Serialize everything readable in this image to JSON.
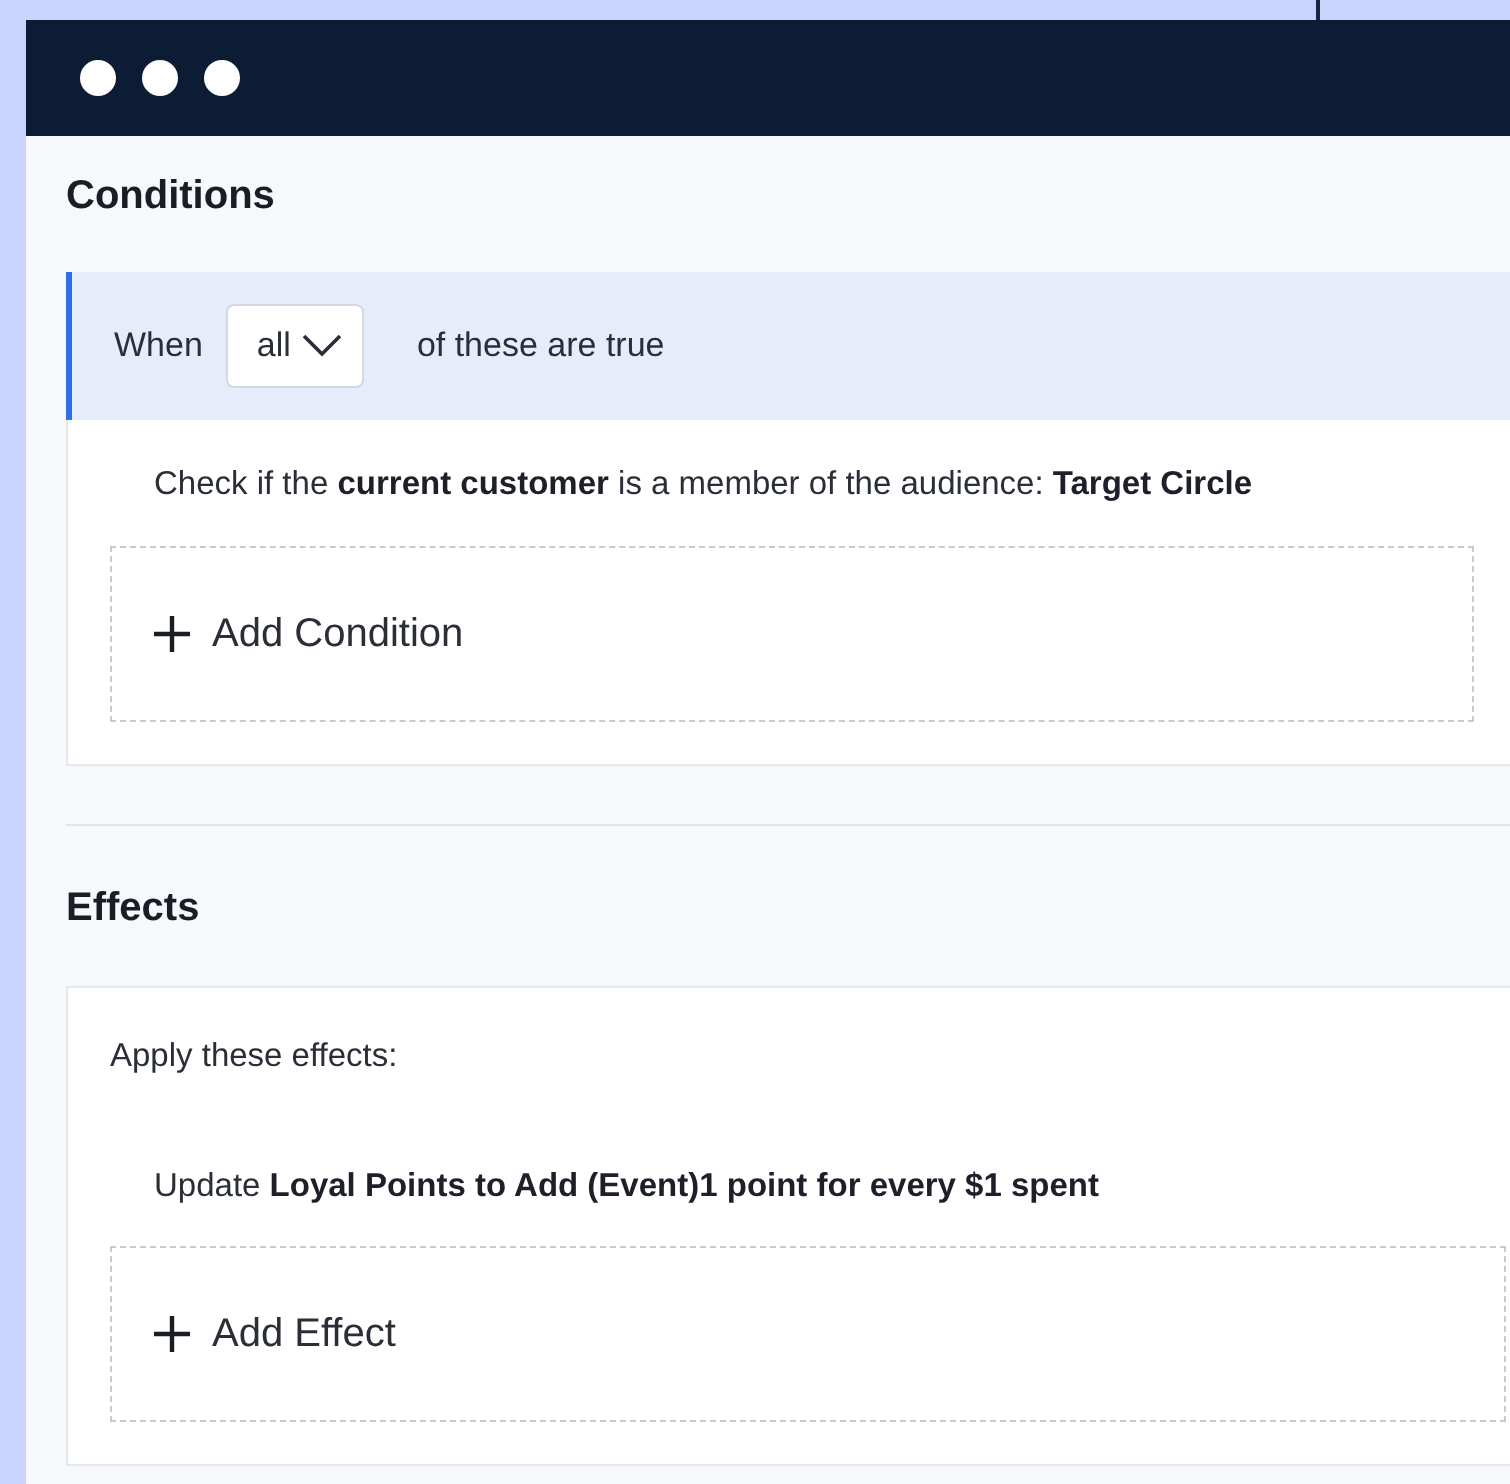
{
  "window": {
    "controls": [
      {
        "kind": "dot"
      },
      {
        "kind": "dot"
      },
      {
        "kind": "dot"
      }
    ]
  },
  "conditions": {
    "title": "Conditions",
    "group": {
      "prefix": "When",
      "quantifier": "all",
      "suffix": "of these are true",
      "focused": true
    },
    "items": [
      "Check if the **current customer** is a member of the audience: **Target Circle**"
    ],
    "add_button": "Add Condition"
  },
  "effects": {
    "title": "Effects",
    "intro": "Apply these effects:",
    "items": [
      "Update **Loyal Points to Add (Event)1 point for every $1 spent**"
    ],
    "add_button": "Add Effect"
  }
}
